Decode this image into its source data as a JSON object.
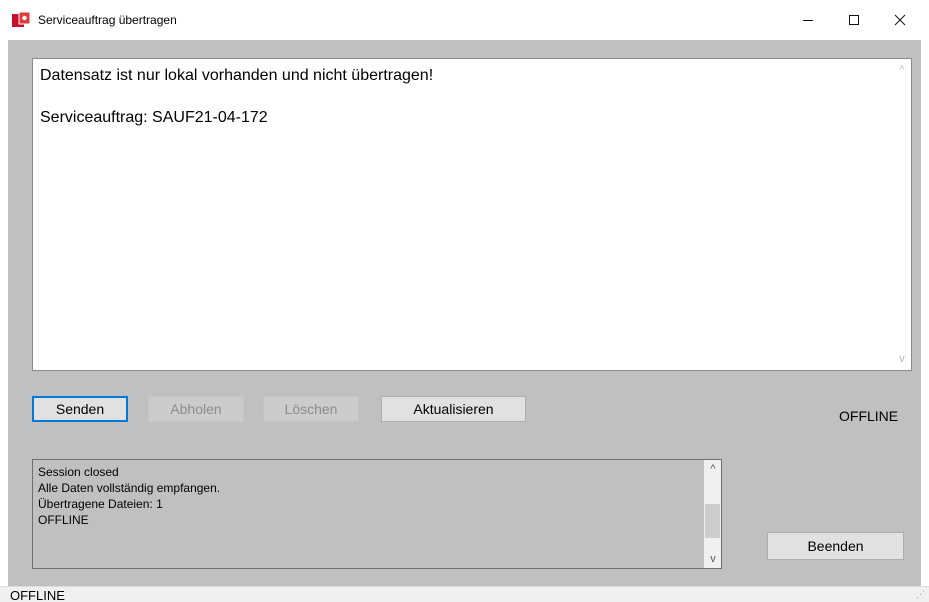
{
  "window": {
    "title": "Serviceauftrag übertragen",
    "icon": "app-icon",
    "controls": {
      "minimize": "—",
      "maximize": "☐",
      "close": "✕"
    }
  },
  "message": {
    "line1": "Datensatz ist nur lokal vorhanden und nicht übertragen!",
    "line2": "Serviceauftrag: SAUF21-04-172"
  },
  "buttons": {
    "send": "Senden",
    "fetch": "Abholen",
    "delete": "Löschen",
    "refresh": "Aktualisieren",
    "exit": "Beenden"
  },
  "connection_status": "OFFLINE",
  "log": {
    "lines": [
      "Session closed",
      "Alle Daten vollständig empfangen.",
      "Übertragene Dateien: 1",
      "OFFLINE"
    ]
  },
  "scroll_arrows": {
    "up": "^",
    "down": "v"
  },
  "statusbar": {
    "text": "OFFLINE",
    "grip": "⋰"
  },
  "colors": {
    "focus": "#0078d7",
    "client_bg": "#c0c0c0",
    "app_icon": "#c8102e"
  }
}
